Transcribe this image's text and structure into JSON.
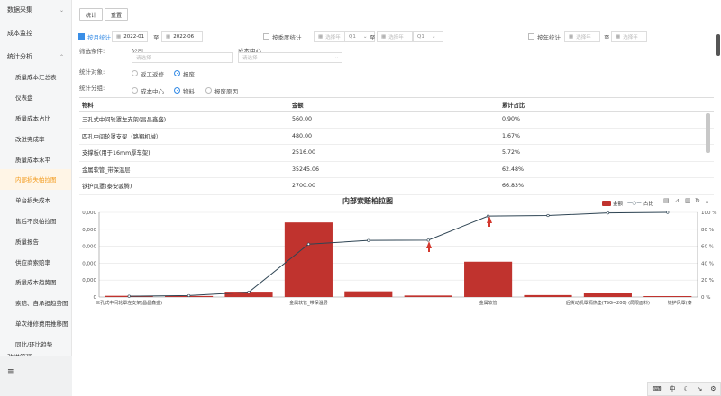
{
  "sidebar": {
    "groups": [
      {
        "label": "数据采集",
        "chevron": "down"
      },
      {
        "label": "成本监控",
        "chevron": ""
      },
      {
        "label": "统计分析",
        "chevron": "up"
      }
    ],
    "items": [
      {
        "label": "质量成本汇总表",
        "active": false
      },
      {
        "label": "仪表盘",
        "active": false
      },
      {
        "label": "质量成本占比",
        "active": false
      },
      {
        "label": "改进完成率",
        "active": false
      },
      {
        "label": "质量成本水平",
        "active": false
      },
      {
        "label": "内部损失帕拉图",
        "active": true
      },
      {
        "label": "单台损失成本",
        "active": false
      },
      {
        "label": "售后不良帕拉图",
        "active": false
      },
      {
        "label": "质量报告",
        "active": false
      },
      {
        "label": "供应商索赔率",
        "active": false
      },
      {
        "label": "质量成本趋势图",
        "active": false
      },
      {
        "label": "索赔、自承担趋势图",
        "active": false
      },
      {
        "label": "单次维修费用推移图",
        "active": false
      },
      {
        "label": "同比/环比趋势",
        "active": false
      }
    ],
    "last_group": {
      "label": "改进管理",
      "chevron": "down"
    }
  },
  "toolbar": {
    "stat_label": "统计",
    "reset_label": "重置"
  },
  "filters": {
    "by_month": {
      "label": "按月统计",
      "checked": true,
      "start": "2022-01",
      "to": "至",
      "end": "2022-06"
    },
    "by_quarter": {
      "label": "按季度统计",
      "checked": false,
      "ph1": "选择年",
      "q1": "Q1",
      "to": "至",
      "ph2": "选择年",
      "q2": "Q1"
    },
    "by_year": {
      "label": "按年统计",
      "checked": false,
      "ph1": "选择年",
      "to": "至",
      "ph2": "选择年"
    },
    "screen_label": "筛选条件:",
    "company_label": "公司",
    "company_ph": "请选择",
    "cost_center_label": "成本中心",
    "cost_center_ph": "请选择",
    "object_label": "统计对象:",
    "objects": [
      {
        "label": "返工返修",
        "on": false
      },
      {
        "label": "报废",
        "on": true
      }
    ],
    "group_label": "统计分组:",
    "groups": [
      {
        "label": "成本中心",
        "on": false
      },
      {
        "label": "物料",
        "on": true
      },
      {
        "label": "报废原因",
        "on": false
      }
    ]
  },
  "table": {
    "headers": [
      "物料",
      "金额",
      "累计占比"
    ],
    "rows": [
      [
        "三孔式中间轮罩左支架(昌昌鑫盛)",
        "560.00",
        "0.90%"
      ],
      [
        "四孔中间轮罩支架（路翔机械）",
        "480.00",
        "1.67%"
      ],
      [
        "支撑板(用于16mm厚车架)",
        "2516.00",
        "5.72%"
      ],
      [
        "金属软管_带保温层",
        "35245.06",
        "62.48%"
      ],
      [
        "铁护风罩(泰安骏腾)",
        "2700.00",
        "66.83%"
      ]
    ]
  },
  "chart_data": {
    "type": "bar",
    "title": "内部索赔柏拉图",
    "legend": [
      "金额",
      "占比"
    ],
    "y_left_ticks": [
      "0,000",
      "0,000",
      "0,000",
      "0,000",
      "0,000",
      "0"
    ],
    "y_right_ticks": [
      "100 %",
      "80 %",
      "60 %",
      "40 %",
      "20 %",
      "0 %"
    ],
    "x_labels": [
      "三孔式中间轮罩左支架(昌昌鑫盛)",
      "金属软管_带保温层",
      "金属软管",
      "后货动机罩隔热垫(TSG=200) (局限面料)",
      "铁护风罩(泰"
    ],
    "bar_values": [
      560,
      480,
      2516,
      35245.06,
      2700,
      700,
      16700,
      900,
      1900,
      400
    ],
    "pct_values": [
      0.9,
      1.67,
      5.72,
      62.48,
      66.83,
      67.2,
      95.6,
      96.3,
      99.3,
      100
    ],
    "ylim": [
      0,
      40000
    ],
    "colors": {
      "bar": "#c0332e",
      "line": "#2f4554",
      "annotation": "#d3382e"
    }
  },
  "bottom_bar": {
    "lang": "中"
  },
  "icons": [
    "hamburger-icon",
    "calendar-icon",
    "chevron-down-icon",
    "download-icon",
    "refresh-icon"
  ]
}
